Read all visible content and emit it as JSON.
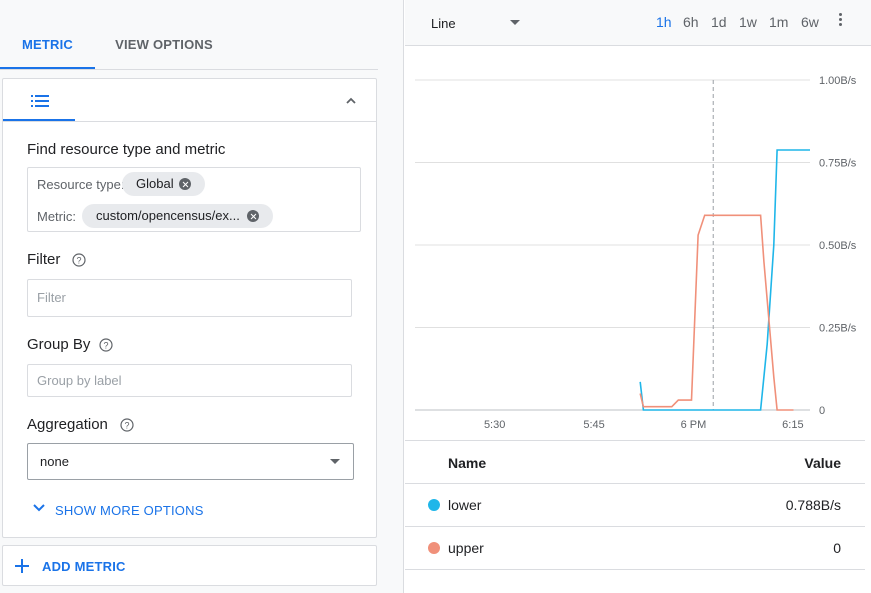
{
  "tabs": {
    "metric": "METRIC",
    "view_options": "VIEW OPTIONS"
  },
  "icons": {
    "list": "list-icon",
    "collapse": "chevron-up-icon",
    "help": "help-circle-icon",
    "remove": "close-circle-icon",
    "expand": "chevron-down-icon",
    "add": "plus-icon",
    "more": "more-vert-icon"
  },
  "metric_card": {
    "find_title": "Find resource type and metric",
    "resource_type_label": "Resource type:",
    "resource_type_value": "Global",
    "metric_label": "Metric:",
    "metric_value": "custom/opencensus/ex...",
    "filter_title": "Filter",
    "filter_placeholder": "Filter",
    "group_by_title": "Group By",
    "group_by_placeholder": "Group by label",
    "aggregation_title": "Aggregation",
    "aggregation_value": "none",
    "show_more": "SHOW MORE OPTIONS"
  },
  "add_metric": "ADD METRIC",
  "chart_toolbar": {
    "chart_type": "Line",
    "ranges": [
      "1h",
      "6h",
      "1d",
      "1w",
      "1m",
      "6w"
    ],
    "active_range": "1h"
  },
  "colors": {
    "accent": "#1a73e8",
    "lower": "#1fb6e9",
    "upper": "#f0907a"
  },
  "chart_data": {
    "type": "line",
    "x_ticks": [
      "5:30",
      "5:45",
      "6 PM",
      "6:15"
    ],
    "y_ticks": [
      "0",
      "0.25B/s",
      "0.50B/s",
      "0.75B/s",
      "1.00B/s"
    ],
    "ylim": [
      0,
      1.0
    ],
    "y_unit": "B/s",
    "xlim": [
      0,
      60
    ],
    "x_tick_values": [
      12.1,
      27.2,
      42.3,
      57.4
    ],
    "cursor_x": 45.3,
    "series": [
      {
        "name": "lower",
        "color": "#1fb6e9",
        "points": [
          [
            34.2,
            0.085
          ],
          [
            34.7,
            0.0
          ],
          [
            52.5,
            0.0
          ],
          [
            53.5,
            0.2
          ],
          [
            54.5,
            0.5
          ],
          [
            55.0,
            0.788
          ],
          [
            60.0,
            0.788
          ]
        ]
      },
      {
        "name": "upper",
        "color": "#f0907a",
        "points": [
          [
            34.2,
            0.05
          ],
          [
            34.7,
            0.01
          ],
          [
            39.0,
            0.01
          ],
          [
            40.0,
            0.03
          ],
          [
            42.0,
            0.03
          ],
          [
            43.0,
            0.53
          ],
          [
            44.0,
            0.59
          ],
          [
            52.5,
            0.59
          ],
          [
            53.0,
            0.45
          ],
          [
            54.5,
            0.1
          ],
          [
            55.0,
            0.0
          ],
          [
            57.5,
            0.0
          ]
        ]
      }
    ],
    "legend_headers": {
      "name": "Name",
      "value": "Value"
    },
    "legend": [
      {
        "name": "lower",
        "value": "0.788B/s",
        "color": "#1fb6e9"
      },
      {
        "name": "upper",
        "value": "0",
        "color": "#f0907a"
      }
    ]
  }
}
